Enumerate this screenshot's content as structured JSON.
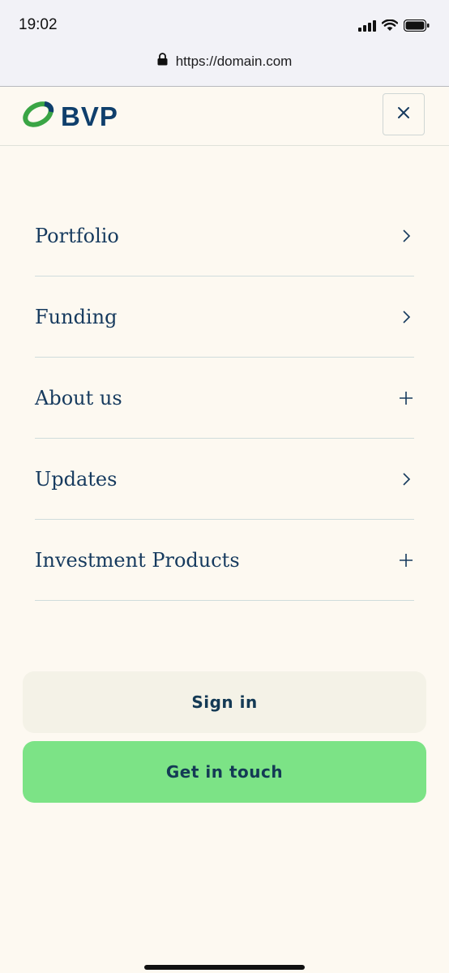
{
  "status_bar": {
    "time": "19:02",
    "icons": [
      "signal-icon",
      "wifi-icon",
      "battery-icon"
    ]
  },
  "browser": {
    "url": "https://domain.com",
    "lock_icon": "lock-icon"
  },
  "header": {
    "logo_text": "BVP",
    "logo_colors": {
      "green": "#3aa545",
      "blue": "#0f3f6c"
    },
    "close_icon": "close-icon"
  },
  "nav": {
    "items": [
      {
        "label": "Portfolio",
        "icon": "chevron-right-icon"
      },
      {
        "label": "Funding",
        "icon": "chevron-right-icon"
      },
      {
        "label": "About us",
        "icon": "plus-icon"
      },
      {
        "label": "Updates",
        "icon": "chevron-right-icon"
      },
      {
        "label": "Investment Products",
        "icon": "plus-icon"
      }
    ]
  },
  "actions": {
    "sign_in_label": "Sign in",
    "get_in_touch_label": "Get in touch",
    "accent_color": "#7ce386"
  }
}
